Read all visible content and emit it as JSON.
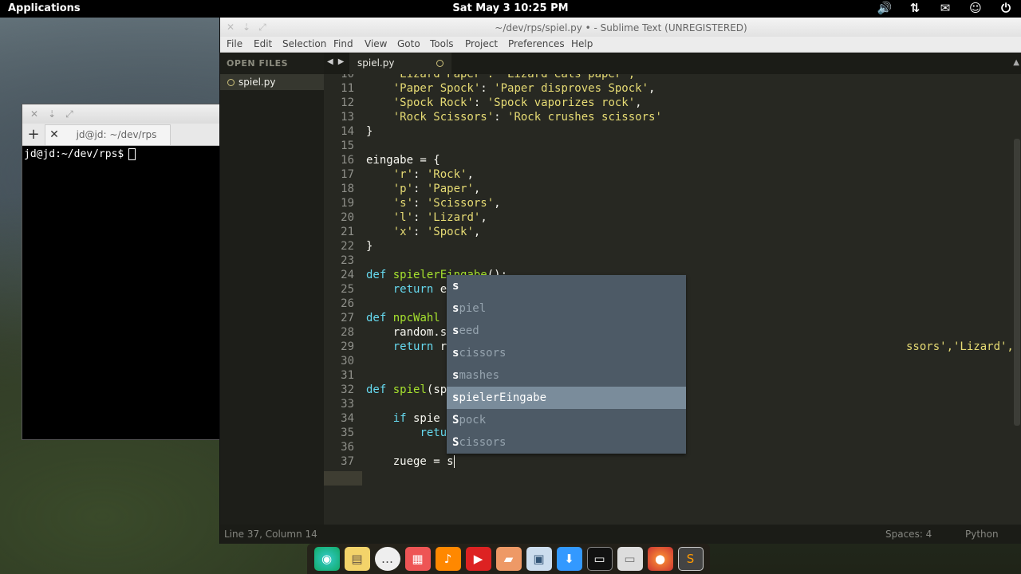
{
  "top_panel": {
    "applications": "Applications",
    "clock": "Sat May  3 10:25 PM",
    "tray_icons": [
      "volume-icon",
      "network-icon",
      "mail-icon",
      "user-icon",
      "power-icon"
    ]
  },
  "terminal": {
    "tab_title": "jd@jd: ~/dev/rps",
    "prompt": "jd@jd:~/dev/rps$"
  },
  "sublime": {
    "title": "~/dev/rps/spiel.py • - Sublime Text (UNREGISTERED)",
    "menu": [
      "File",
      "Edit",
      "Selection",
      "Find",
      "View",
      "Goto",
      "Tools",
      "Project",
      "Preferences",
      "Help"
    ],
    "sidebar": {
      "header": "OPEN FILES",
      "file": "spiel.py"
    },
    "tab": {
      "label": "spiel.py"
    },
    "status": {
      "position": "Line 37, Column 14",
      "spaces": "Spaces: 4",
      "syntax": "Python"
    }
  },
  "editor": {
    "lines": [
      {
        "n": "11",
        "c": ""
      },
      {
        "n": "12",
        "c": ""
      },
      {
        "n": "13",
        "c": ""
      },
      {
        "n": "14",
        "c": "}"
      },
      {
        "n": "15",
        "c": ""
      },
      {
        "n": "16",
        "c": "eingabe = {"
      },
      {
        "n": "17",
        "c": ""
      },
      {
        "n": "18",
        "c": ""
      },
      {
        "n": "19",
        "c": ""
      },
      {
        "n": "20",
        "c": ""
      },
      {
        "n": "21",
        "c": ""
      },
      {
        "n": "22",
        "c": "}"
      },
      {
        "n": "23",
        "c": ""
      },
      {
        "n": "24",
        "c": ""
      },
      {
        "n": "25",
        "c": ""
      },
      {
        "n": "26",
        "c": ""
      },
      {
        "n": "27",
        "c": ""
      },
      {
        "n": "28",
        "c": "    random.s"
      },
      {
        "n": "29",
        "c": ""
      },
      {
        "n": "30",
        "c": ""
      },
      {
        "n": "31",
        "c": ""
      },
      {
        "n": "32",
        "c": ""
      },
      {
        "n": "33",
        "c": ""
      },
      {
        "n": "34",
        "c": ""
      },
      {
        "n": "35",
        "c": ""
      },
      {
        "n": "36",
        "c": ""
      },
      {
        "n": "37",
        "c": "    zuege = s"
      }
    ],
    "line10_partial": "    'Lizard Paper': 'Lizard eats paper',",
    "l11_key": "'Paper Spock'",
    "l11_val": "'Paper disproves Spock'",
    "l12_key": "'Spock Rock'",
    "l12_val": "'Spock vaporizes rock'",
    "l13_key": "'Rock Scissors'",
    "l13_val": "'Rock crushes scissors'",
    "l17_k": "'r'",
    "l17_v": "'Rock'",
    "l18_k": "'p'",
    "l18_v": "'Paper'",
    "l19_k": "'s'",
    "l19_v": "'Scissors'",
    "l20_k": "'l'",
    "l20_v": "'Lizard'",
    "l21_k": "'x'",
    "l21_v": "'Spock'",
    "l24_def": "def",
    "l24_fn": "spielerEingabe",
    "l24_rest": "():",
    "l25_kw": "return",
    "l25_rest": " e",
    "l27_def": "def",
    "l27_fn": "npcWahl",
    "l29_kw": "return",
    "l29_rest": " r",
    "l29_tail": "ssors','Lizard','Spock'])",
    "l32_def": "def",
    "l32_fn": "spiel",
    "l32_rest": "(sp",
    "l34_kw": "if",
    "l34_rest": " spie",
    "l35_kw": "retu"
  },
  "autocomplete": {
    "items": [
      {
        "m": "s",
        "r": ""
      },
      {
        "m": "s",
        "r": "piel"
      },
      {
        "m": "s",
        "r": "eed"
      },
      {
        "m": "s",
        "r": "cissors"
      },
      {
        "m": "s",
        "r": "mashes"
      },
      {
        "m": "s",
        "r": "pielerEingabe"
      },
      {
        "m": "S",
        "r": "pock"
      },
      {
        "m": "S",
        "r": "cissors"
      }
    ],
    "selected_index": 5
  },
  "dock": [
    "browser-icon",
    "notes-icon",
    "chat-icon",
    "calendar-icon",
    "music-icon",
    "media-icon",
    "files-folder-icon",
    "apps-icon",
    "download-icon",
    "terminal-icon",
    "folder-icon",
    "firefox-icon",
    "sublime-icon"
  ],
  "colors": {
    "editor_bg": "#272822",
    "string": "#e6db74",
    "keyword": "#66d9ef",
    "function": "#a6e22e",
    "popup_bg": "#4d5a66",
    "popup_sel": "#7a8c9b"
  }
}
